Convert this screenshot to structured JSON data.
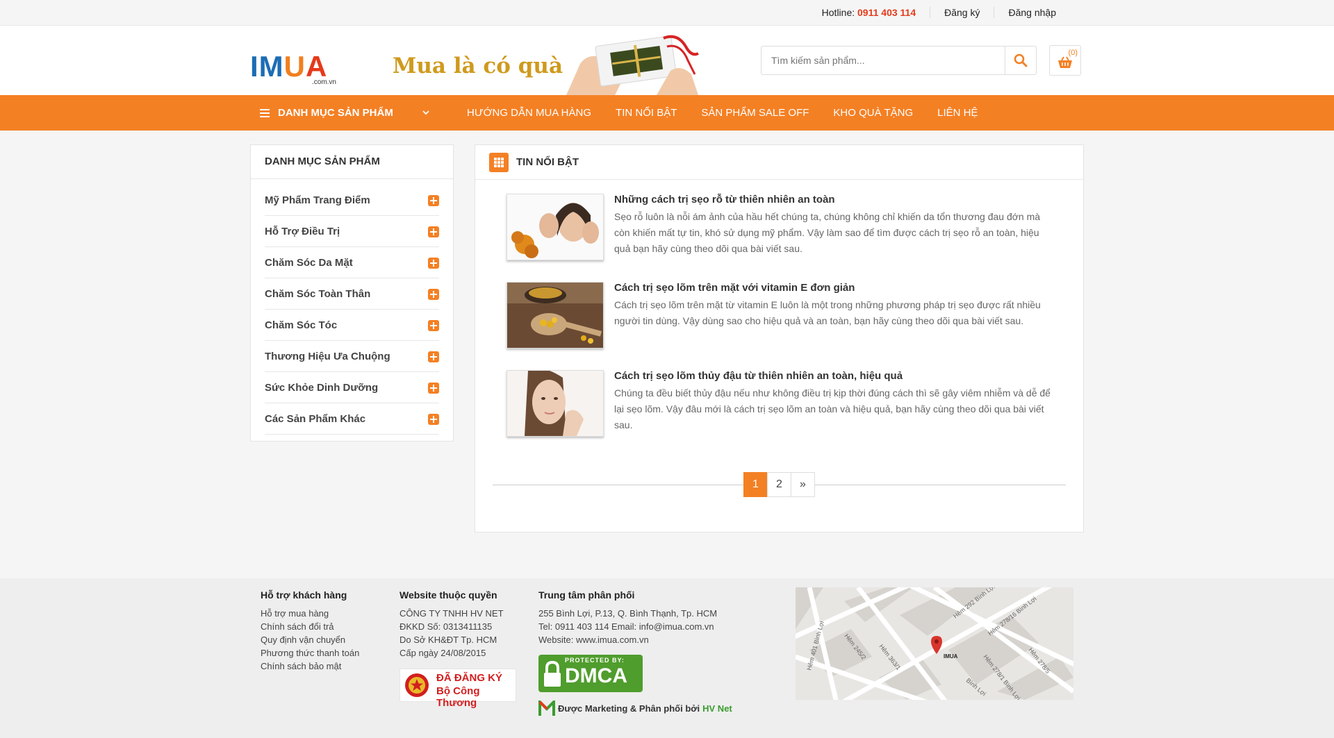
{
  "topbar": {
    "hotline_label": "Hotline:",
    "hotline_number": "0911 403 114",
    "register": "Đăng ký",
    "login": "Đăng nhập"
  },
  "header": {
    "logo_text": "IMUA",
    "logo_sub": ".com.vn",
    "slogan": "Mua là có quà",
    "search_placeholder": "Tìm kiếm sản phẩm...",
    "cart_count": "(0)"
  },
  "nav": {
    "category_label": "DANH MỤC SẢN PHẨM",
    "items": [
      "HƯỚNG DẪN MUA HÀNG",
      "TIN NỔI BẬT",
      "SẢN PHẨM SALE OFF",
      "KHO QUÀ TẶNG",
      "LIÊN HỆ"
    ]
  },
  "sidebar": {
    "title": "DANH MỤC SẢN PHẨM",
    "items": [
      "Mỹ Phẩm Trang Điểm",
      "Hỗ Trợ Điều Trị",
      "Chăm Sóc Da Mặt",
      "Chăm Sóc Toàn Thân",
      "Chăm Sóc Tóc",
      "Thương Hiệu Ưa Chuộng",
      "Sức Khỏe Dinh Dưỡng",
      "Các Sản Phẩm Khác"
    ]
  },
  "main": {
    "title": "TIN NỔI BẬT",
    "posts": [
      {
        "title": "Những cách trị sẹo rỗ từ thiên nhiên an toàn",
        "desc": "Sẹo rỗ luôn là nỗi ám ảnh của hầu hết chúng ta, chúng không chỉ khiến da tổn thương đau đớn mà còn khiến mất tự tin, khó sử dụng mỹ phẩm. Vậy làm sao để tìm được cách trị sẹo rỗ an toàn, hiệu quả bạn hãy cùng theo dõi qua bài viết sau."
      },
      {
        "title": "Cách trị sẹo lõm trên mặt với vitamin E đơn giản",
        "desc": "Cách trị sẹo lõm trên mặt từ vitamin E luôn là một trong những phương pháp trị sẹo được rất nhiều người tin dùng. Vậy dùng sao cho hiệu quả và an toàn, bạn hãy cùng theo dõi qua bài viết sau."
      },
      {
        "title": "Cách trị sẹo lõm thủy đậu từ thiên nhiên an toàn, hiệu quả",
        "desc": "Chúng ta đều biết thủy đậu nếu như không điều trị kịp thời đúng cách thì sẽ gây viêm nhiễm và dễ để lại sẹo lõm. Vậy đâu mới là cách trị sẹo lõm an toàn và hiệu quả, bạn hãy cùng theo dõi qua bài viết sau."
      }
    ],
    "pagination": [
      "1",
      "2",
      "»"
    ]
  },
  "footer": {
    "support": {
      "title": "Hỗ trợ khách hàng",
      "links": [
        "Hỗ trợ mua hàng",
        "Chính sách đổi trả",
        "Quy định vận chuyển",
        "Phương thức thanh toán",
        "Chính sách bảo mật"
      ]
    },
    "owner": {
      "title": "Website thuộc quyền",
      "lines": [
        "CÔNG TY TNHH HV NET",
        "ĐKKD Số: 0313411135",
        "Do Sở KH&ĐT Tp. HCM",
        "Cấp ngày 24/08/2015"
      ],
      "badge_line1": "ĐÃ ĐĂNG KÝ",
      "badge_line2": "Bộ Công Thương"
    },
    "distribution": {
      "title": "Trung tâm phân phối",
      "lines": [
        "255 Bình Lợi, P.13, Q. Bình Thạnh, Tp. HCM",
        "Tel: 0911 403 114 Email: info@imua.com.vn",
        "Website: www.imua.com.vn"
      ],
      "dmca_small": "PROTECTED BY:",
      "dmca_big": "DMCA"
    },
    "marketing_text": "Được Marketing & Phân phối bởi",
    "marketing_brand": "HV Net",
    "map": {
      "pin_label": "IMUA",
      "streets": [
        "Hẻm 292 Bình Lợi",
        "Hẻm 278/16 Bình Lợi",
        "Hẻm 245/2",
        "Hẻm 363/1",
        "Hẻm 401 Bình Lợi",
        "Hẻm 278/1 Bình Lợi",
        "Hẻm 278/5",
        "Bình Lợi"
      ]
    }
  },
  "colors": {
    "accent": "#f48024",
    "hotline": "#e53a1b"
  }
}
